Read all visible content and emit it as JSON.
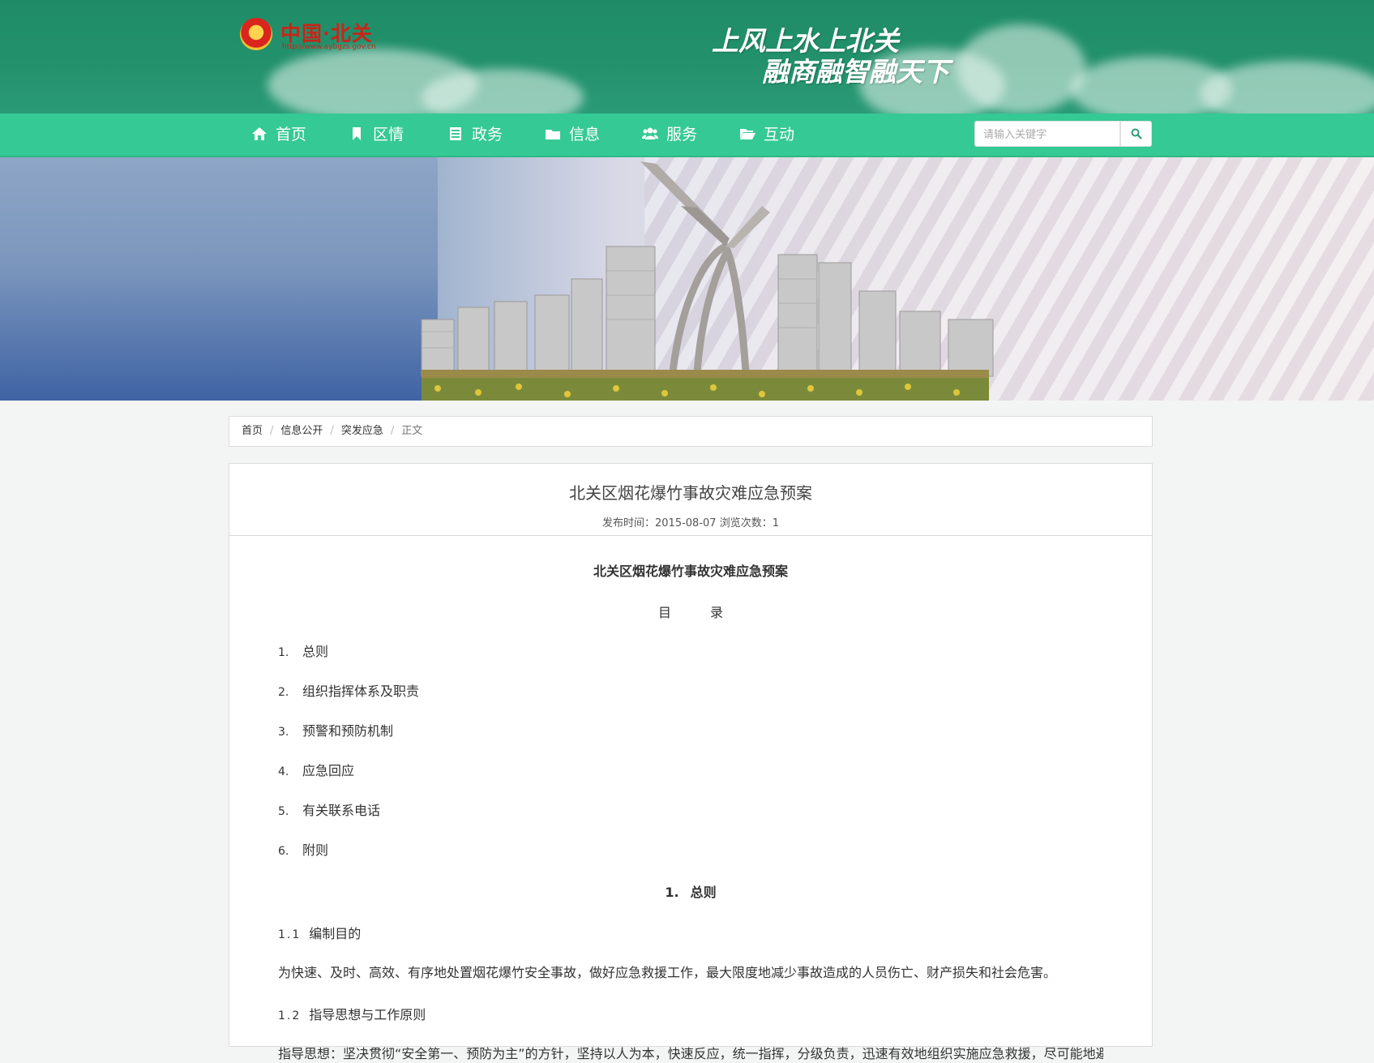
{
  "header": {
    "logo_text": "中国·北关",
    "logo_url": "http://www.aybgzs.gov.cn",
    "slogan_line1": "上风上水上北关",
    "slogan_line2": "融商融智融天下"
  },
  "nav": {
    "items": [
      {
        "label": "首页",
        "icon": "home-icon"
      },
      {
        "label": "区情",
        "icon": "bookmark-icon"
      },
      {
        "label": "政务",
        "icon": "list-icon"
      },
      {
        "label": "信息",
        "icon": "folder-icon"
      },
      {
        "label": "服务",
        "icon": "users-icon"
      },
      {
        "label": "互动",
        "icon": "folder-open-icon"
      }
    ],
    "search_placeholder": "请输入关键字"
  },
  "breadcrumb": {
    "items": [
      "首页",
      "信息公开",
      "突发应急"
    ],
    "current": "正文"
  },
  "article": {
    "title": "北关区烟花爆竹事故灾难应急预案",
    "meta": "发布时间：2015-08-07 浏览次数：1",
    "doc_title": "北关区烟花爆竹事故灾难应急预案",
    "toc_title_a": "目",
    "toc_title_b": "录",
    "toc": [
      {
        "num": "1.",
        "label": "总则"
      },
      {
        "num": "2.",
        "label": "组织指挥体系及职责"
      },
      {
        "num": "3.",
        "label": "预警和预防机制"
      },
      {
        "num": "4.",
        "label": "应急回应"
      },
      {
        "num": "5.",
        "label": "有关联系电话"
      },
      {
        "num": "6.",
        "label": "附则"
      }
    ],
    "section1": {
      "num": "1.",
      "label": "总则"
    },
    "sub1": {
      "num": "1.1",
      "label": "编制目的"
    },
    "para1": "为快速、及时、高效、有序地处置烟花爆竹安全事故，做好应急救援工作，最大限度地减少事故造成的人员伤亡、财产损失和社会危害。",
    "sub2": {
      "num": "1.2",
      "label": "指导思想与工作原则"
    },
    "para2": "指导思想：坚决贯彻“安全第一、预防为主”的方针，坚持以人为本，快速反应，统一指挥，分级负责，迅速有效地组织实施应急救援，尽可能地避免和减少损失，维护"
  }
}
